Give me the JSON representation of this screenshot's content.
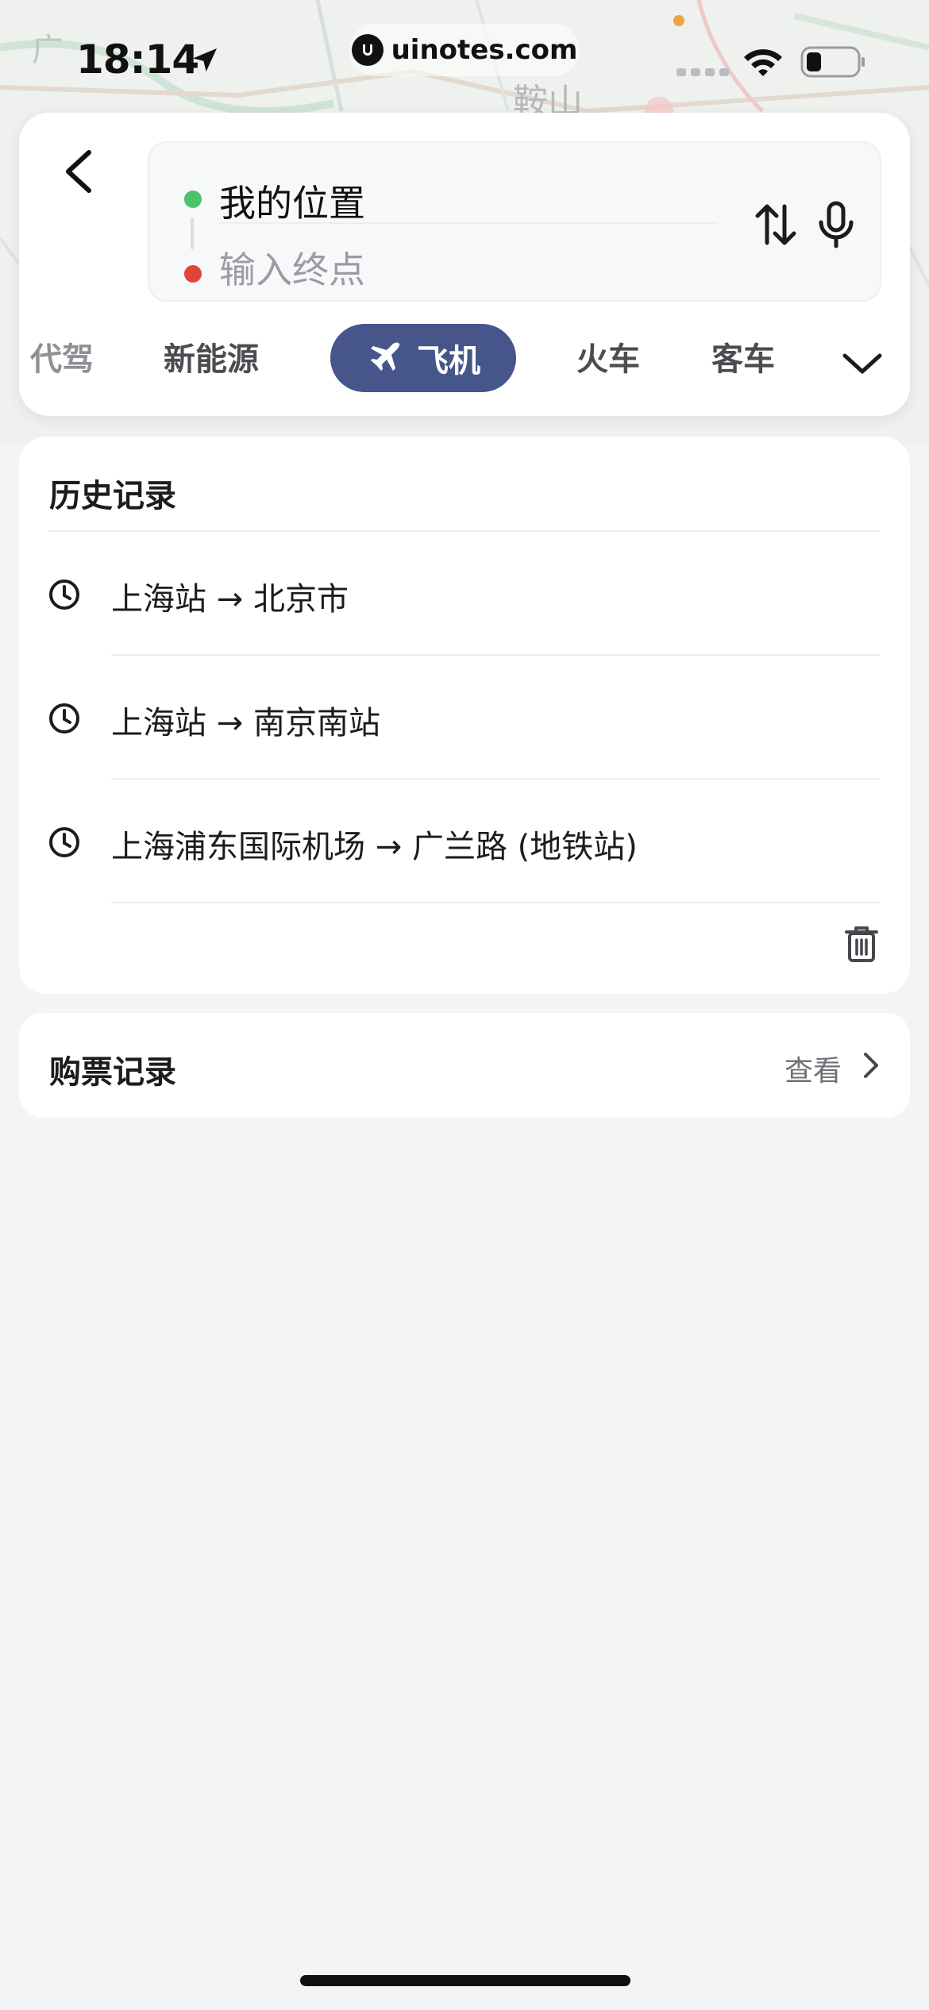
{
  "status_bar": {
    "time": "18:14",
    "url": "uinotes.com",
    "icons": [
      "location-arrow-icon",
      "wifi-icon",
      "battery-icon"
    ]
  },
  "map": {
    "labels": [
      "广",
      "鞍山"
    ]
  },
  "route": {
    "start": "我的位置",
    "end_placeholder": "输入终点"
  },
  "transport_modes": {
    "items": [
      "代驾",
      "新能源",
      "飞机",
      "火车",
      "客车"
    ],
    "active": "飞机",
    "active_color": "#46568a"
  },
  "history": {
    "title": "历史记录",
    "items": [
      "上海站 → 北京市",
      "上海站 → 南京南站",
      "上海浦东国际机场 → 广兰路 (地铁站)"
    ]
  },
  "tickets": {
    "title": "购票记录",
    "view_label": "查看"
  }
}
